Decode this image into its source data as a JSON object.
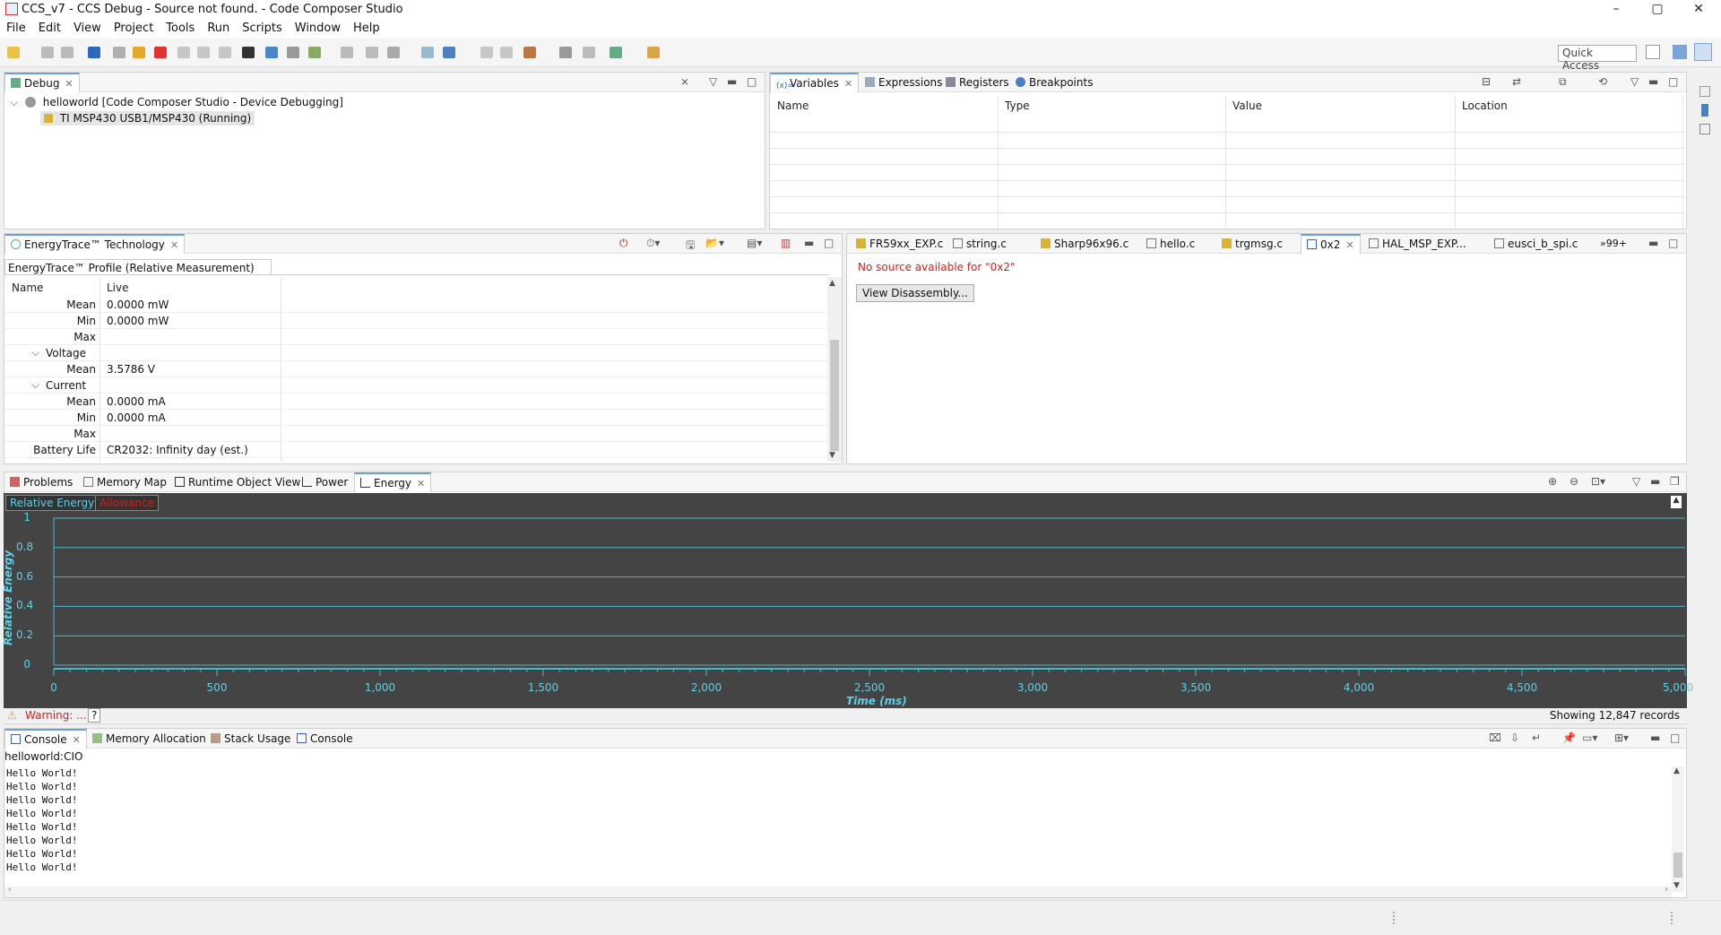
{
  "window": {
    "title": "CCS_v7 - CCS Debug - Source not found. - Code Composer Studio",
    "min": "–",
    "max": "▢",
    "close": "✕"
  },
  "menu": [
    "File",
    "Edit",
    "View",
    "Project",
    "Tools",
    "Run",
    "Scripts",
    "Window",
    "Help"
  ],
  "toolbar": {
    "quick_access": "Quick Access"
  },
  "debug": {
    "tab": "Debug",
    "root": "helloworld [Code Composer Studio - Device Debugging]",
    "child": "TI MSP430 USB1/MSP430 (Running)"
  },
  "variables": {
    "tabs": [
      "Variables",
      "Expressions",
      "Registers",
      "Breakpoints"
    ],
    "columns": [
      "Name",
      "Type",
      "Value",
      "Location"
    ]
  },
  "energytrace": {
    "tab": "EnergyTrace™ Technology",
    "subtab": "EnergyTrace™ Profile (Relative Measurement)",
    "columns": [
      "Name",
      "Live"
    ],
    "rows": [
      {
        "name": "Mean",
        "value": "0.0000 mW",
        "indent": 2
      },
      {
        "name": "Min",
        "value": "0.0000 mW",
        "indent": 2
      },
      {
        "name": "Max",
        "value": "",
        "indent": 2
      },
      {
        "name": "Voltage",
        "value": "",
        "indent": 1,
        "group": true
      },
      {
        "name": "Mean",
        "value": "3.5786 V",
        "indent": 2
      },
      {
        "name": "Current",
        "value": "",
        "indent": 1,
        "group": true
      },
      {
        "name": "Mean",
        "value": "0.0000 mA",
        "indent": 2
      },
      {
        "name": "Min",
        "value": "0.0000 mA",
        "indent": 2
      },
      {
        "name": "Max",
        "value": "",
        "indent": 2
      },
      {
        "name": "Battery Life",
        "value": "CR2032: Infinity day (est.)",
        "indent": 1
      }
    ]
  },
  "editor": {
    "tabs": [
      "FR59xx_EXP.c",
      "string.c",
      "Sharp96x96.c",
      "hello.c",
      "trgmsg.c",
      "0x2",
      "HAL_MSP_EXP...",
      "eusci_b_spi.c"
    ],
    "active": "0x2",
    "overflow": "»99+",
    "message": "No source available for \"0x2\"",
    "button": "View Disassembly..."
  },
  "bottom": {
    "tabs": [
      "Problems",
      "Memory Map",
      "Runtime Object View",
      "Power",
      "Energy"
    ],
    "active": "Energy",
    "chart_tabs": [
      "Relative Energy",
      "Allowance"
    ]
  },
  "chart_data": {
    "type": "line",
    "xlabel": "Time (ms)",
    "ylabel": "Relative Energy",
    "xlim": [
      0,
      5000
    ],
    "ylim": [
      0,
      1
    ],
    "x_ticks": [
      "0",
      "500",
      "1,000",
      "1,500",
      "2,000",
      "2,500",
      "3,000",
      "3,500",
      "4,000",
      "4,500",
      "5,000"
    ],
    "y_ticks": [
      "0",
      "0.2",
      "0.4",
      "0.6",
      "0.8",
      "1"
    ],
    "series": [],
    "grid": true
  },
  "status": {
    "warning": "Warning: ...",
    "help": "?",
    "records": "Showing 12,847 records"
  },
  "console": {
    "tabs": [
      "Console",
      "Memory Allocation",
      "Stack Usage",
      "Console"
    ],
    "label": "helloworld:CIO",
    "lines": [
      "Hello World!",
      "Hello World!",
      "Hello World!",
      "Hello World!",
      "Hello World!",
      "Hello World!",
      "Hello World!",
      "Hello World!"
    ]
  }
}
